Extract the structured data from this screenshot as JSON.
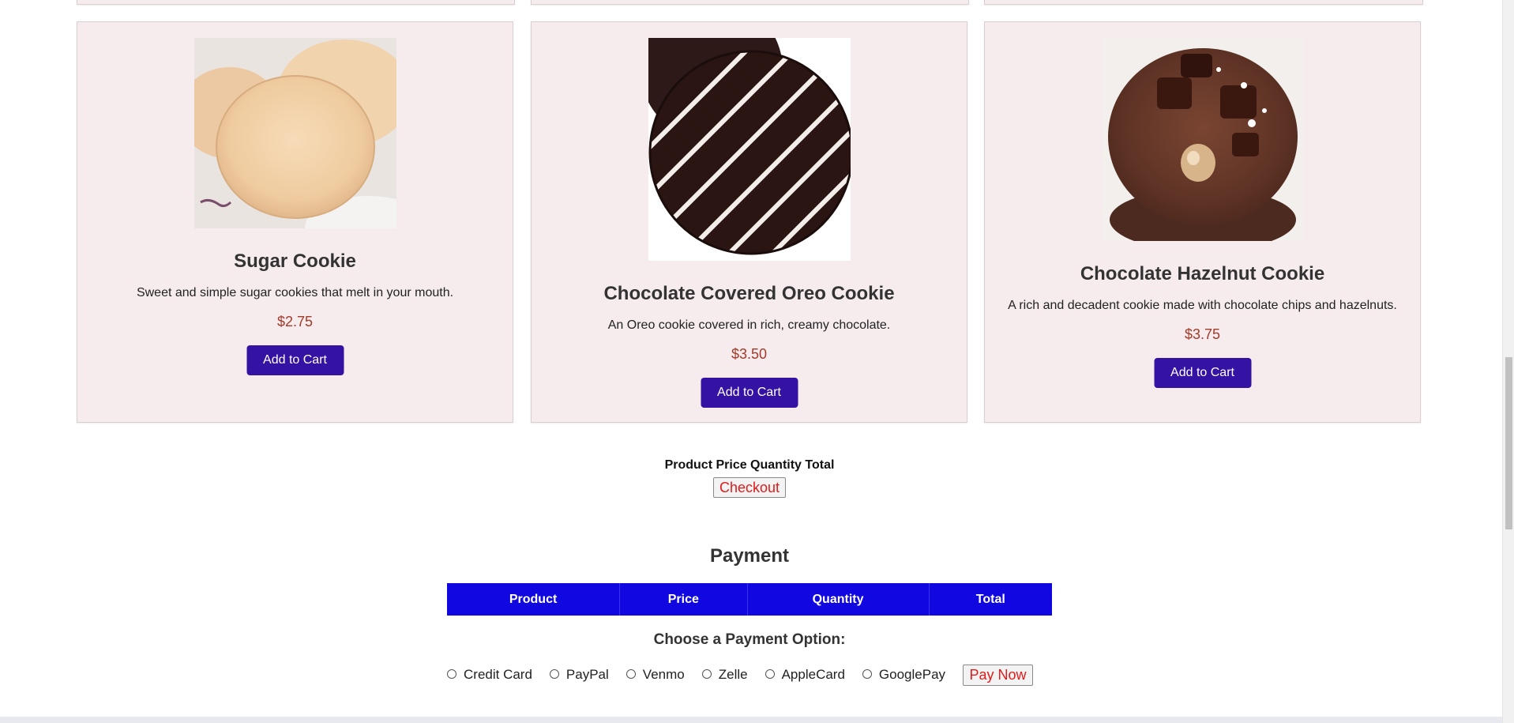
{
  "products": [
    {
      "name": "Sugar Cookie",
      "description": "Sweet and simple sugar cookies that melt in your mouth.",
      "price": "$2.75",
      "button_label": "Add to Cart"
    },
    {
      "name": "Chocolate Covered Oreo Cookie",
      "description": "An Oreo cookie covered in rich, creamy chocolate.",
      "price": "$3.50",
      "button_label": "Add to Cart"
    },
    {
      "name": "Chocolate Hazelnut Cookie",
      "description": "A rich and decadent cookie made with chocolate chips and hazelnuts.",
      "price": "$3.75",
      "button_label": "Add to Cart"
    }
  ],
  "cart": {
    "header": "Product Price Quantity Total",
    "checkout_label": "Checkout"
  },
  "payment": {
    "title": "Payment",
    "table_headers": [
      "Product",
      "Price",
      "Quantity",
      "Total"
    ],
    "choose_label": "Choose a Payment Option:",
    "options": [
      "Credit Card",
      "PayPal",
      "Venmo",
      "Zelle",
      "AppleCard",
      "GooglePay"
    ],
    "pay_now_label": "Pay Now"
  },
  "colors": {
    "card_background": "#f6eced",
    "button_primary": "#3412a3",
    "price": "#a33a2a",
    "table_header": "#1107e0",
    "action_text": "#e01b1b"
  }
}
